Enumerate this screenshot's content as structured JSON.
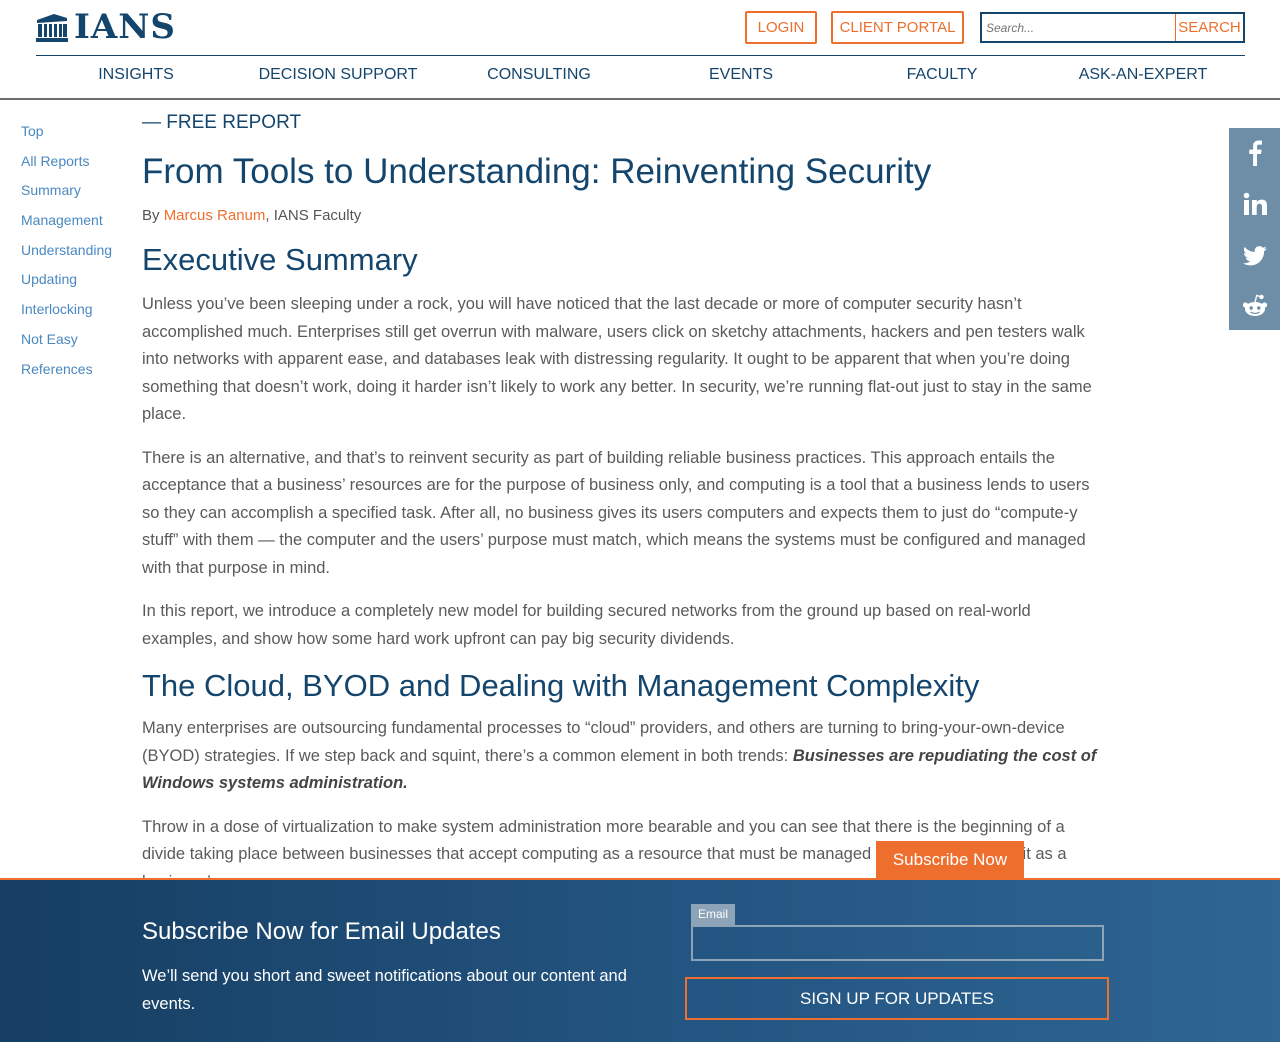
{
  "header": {
    "logo_text": "IANS",
    "login_label": "LOGIN",
    "client_portal_label": "CLIENT PORTAL",
    "search_placeholder": "Search...",
    "search_button_label": "SEARCH",
    "nav": [
      "INSIGHTS",
      "DECISION SUPPORT",
      "CONSULTING",
      "EVENTS",
      "FACULTY",
      "ASK-AN-EXPERT"
    ]
  },
  "sidebar": {
    "items": [
      "Top",
      "All Reports",
      "Summary",
      "Management",
      "Understanding",
      "Updating",
      "Interlocking",
      "Not Easy",
      "References"
    ]
  },
  "article": {
    "kicker": "— FREE REPORT",
    "title": "From Tools to Understanding: Reinventing Security",
    "byline_prefix": "By ",
    "author": "Marcus Ranum",
    "byline_suffix": ", IANS Faculty",
    "section1_heading": "Executive Summary",
    "p1": "Unless you’ve been sleeping under a rock, you will have noticed that the last decade or more of computer security hasn’t accomplished much. Enterprises still get overrun with malware, users click on sketchy attachments, hackers and pen testers walk into networks with apparent ease, and databases leak with distressing regularity. It ought to be apparent that when you’re doing something that doesn’t work, doing it harder isn’t likely to work any better. In security, we’re running flat-out just to stay in the same place.",
    "p2": "There is an alternative, and that’s to reinvent security as part of building reliable business practices. This approach entails the acceptance that a business’ resources are for the purpose of business only, and computing is a tool that a business lends to users so they can accomplish a specified task. After all, no business gives its users computers and expects them to just do “compute-y stuff” with them — the computer and the users’ purpose must match, which means the systems must be configured and managed with that purpose in mind.",
    "p3": "In this report, we introduce a completely new model for building secured networks from the ground up based on real-world examples, and show how some hard work upfront can pay big security dividends.",
    "section2_heading": "The Cloud, BYOD and Dealing with Management Complexity",
    "p4_text": "Many enterprises are outsourcing fundamental processes to “cloud” providers, and others are turning to bring-your-own-device (BYOD) strategies. If we step back and squint, there’s a common element in both trends: ",
    "p4_emphasis": "Businesses are repudiating the cost of Windows systems administration.",
    "p5": "Throw in a dose of virtualization to make system administration more bearable and you can see that there is the beginning of a divide taking place between businesses that accept computing as a resource that must be managed and those that view it as a business’"
  },
  "social": {
    "icons": [
      "facebook-icon",
      "linkedin-icon",
      "twitter-icon",
      "reddit-icon"
    ]
  },
  "subscribe": {
    "tab_label": "Subscribe Now",
    "title": "Subscribe Now for Email Updates",
    "text": "We’ll send you short and sweet notifications about our content and events.",
    "email_label": "Email",
    "button_label": "SIGN UP FOR UPDATES"
  },
  "colors": {
    "brand_navy": "#14456d",
    "accent_orange": "#ee6f2d",
    "link_blue": "#4a88c1",
    "social_bar": "#6e8ea8"
  }
}
